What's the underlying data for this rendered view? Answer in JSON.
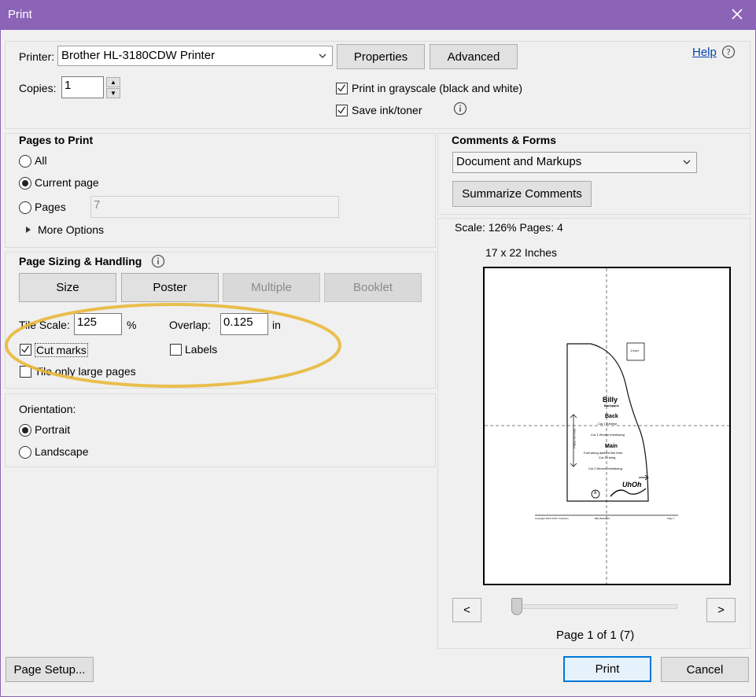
{
  "window": {
    "title": "Print"
  },
  "printer": {
    "label": "Printer:",
    "selected": "Brother HL-3180CDW Printer",
    "properties_label": "Properties",
    "advanced_label": "Advanced",
    "help_label": "Help",
    "copies_label": "Copies:",
    "copies_value": "1",
    "grayscale_label": "Print in grayscale (black and white)",
    "grayscale_checked": true,
    "save_ink_label": "Save ink/toner",
    "save_ink_checked": true
  },
  "pages_to_print": {
    "title": "Pages to Print",
    "all_label": "All",
    "current_label": "Current page",
    "pages_label": "Pages",
    "pages_value": "7",
    "more_options_label": "More Options",
    "selected": "current"
  },
  "sizing": {
    "title": "Page Sizing & Handling",
    "buttons": {
      "size": "Size",
      "poster": "Poster",
      "multiple": "Multiple",
      "booklet": "Booklet"
    },
    "tile_scale_label": "Tile Scale:",
    "tile_scale_value": "125",
    "tile_scale_unit": "%",
    "overlap_label": "Overlap:",
    "overlap_value": "0.125",
    "overlap_unit": "in",
    "cut_marks_label": "Cut marks",
    "cut_marks_checked": true,
    "labels_label": "Labels",
    "labels_checked": false,
    "tile_large_label": "Tile only large pages",
    "tile_large_checked": false
  },
  "orientation": {
    "title": "Orientation:",
    "portrait_label": "Portrait",
    "landscape_label": "Landscape",
    "selected": "portrait"
  },
  "comments": {
    "title": "Comments & Forms",
    "selected": "Document and Markups",
    "summarize_label": "Summarize Comments"
  },
  "preview": {
    "scale_text": "Scale: 126% Pages: 4",
    "size_text": "17 x 22 Inches",
    "page_status": "Page 1 of 1 (7)",
    "prev_label": "<",
    "next_label": ">",
    "slider_fraction": 0,
    "doc": {
      "one_inch": "1 inch",
      "brand": "Billy",
      "brand_sub": "Backpack",
      "back_title": "Back",
      "back_line": "Cut 1 Exterior",
      "interfacing_line": "Cut 1 Woven Interfacing",
      "main_title": "Main",
      "fold_line": "Fold along dashed line then:",
      "lining_line": "Cut 2 Lining",
      "interfacing_line2": "Cut 2 Woven Interfacing",
      "place_on_fold": "Place on Fold",
      "circle_letter": "A",
      "logo_text": "UhOh",
      "footer_left": "Copyright 2019 UhOh Creations",
      "footer_mid": "Billy Backpack",
      "footer_right": "Page 7"
    }
  },
  "footer": {
    "page_setup_label": "Page Setup...",
    "print_label": "Print",
    "cancel_label": "Cancel"
  },
  "colors": {
    "titlebar": "#8b64b8",
    "highlight": "#e8b83a",
    "link": "#0645ad",
    "primary_border": "#0078d7"
  }
}
